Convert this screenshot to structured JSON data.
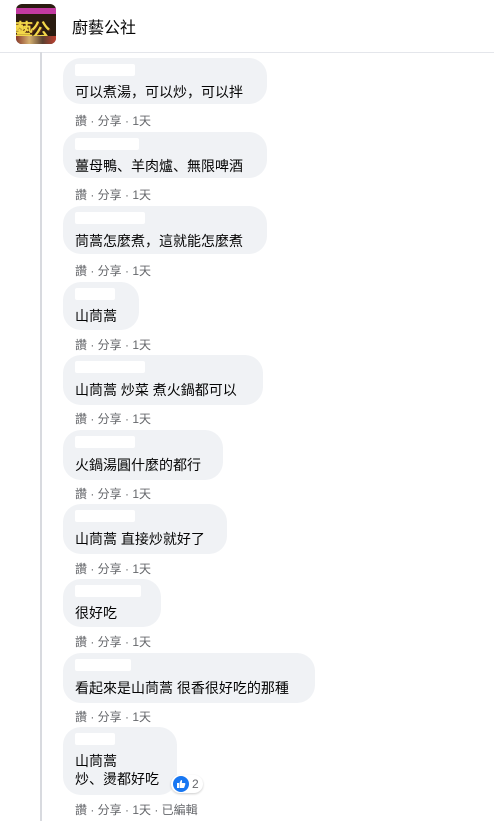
{
  "group": {
    "name": "廚藝公社",
    "avatar_text": "藝公"
  },
  "comments": [
    {
      "text": "可以煮湯，可以炒，可以拌",
      "meta": "讚 · 分享 · 1天"
    },
    {
      "text": "薑母鴨、羊肉爐、無限啤酒",
      "meta": "讚 · 分享 · 1天"
    },
    {
      "text": "茼蒿怎麼煮，這就能怎麼煮",
      "meta": "讚 · 分享 · 1天"
    },
    {
      "text": "山茼蒿",
      "meta": "讚 · 分享 · 1天"
    },
    {
      "text": "山茼蒿 炒菜 煮火鍋都可以",
      "meta": "讚 · 分享 · 1天"
    },
    {
      "text": "火鍋湯圓什麼的都行",
      "meta": "讚 · 分享 · 1天"
    },
    {
      "text": "山茼蒿 直接炒就好了",
      "meta": "讚 · 分享 · 1天"
    },
    {
      "text": "很好吃",
      "meta": "讚 · 分享 · 1天"
    },
    {
      "text": "看起來是山茼蒿 很香很好吃的那種",
      "meta": "讚 · 分享 · 1天"
    },
    {
      "text_line1": "山茼蒿",
      "text_line2": "炒、燙都好吃",
      "meta": "讚 · 分享 · 1天 · 已編輯",
      "reaction_count": "2"
    }
  ]
}
